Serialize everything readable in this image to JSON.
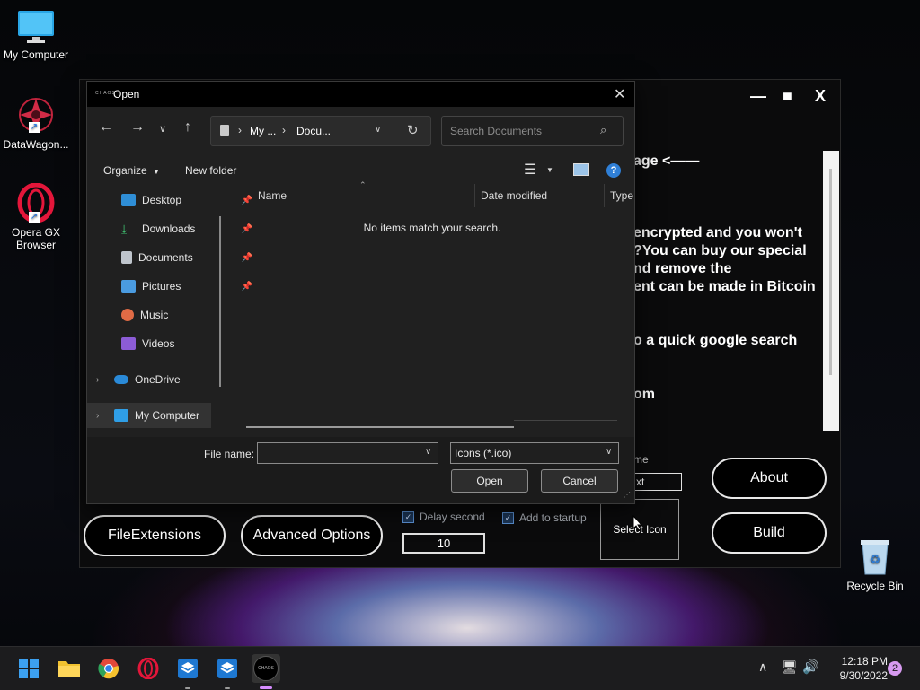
{
  "desktop": {
    "icons": [
      {
        "label": "My Computer"
      },
      {
        "label": "DataWagon..."
      },
      {
        "label": "Opera GX\nBrowser"
      },
      {
        "label": "Recycle Bin"
      }
    ]
  },
  "background_app": {
    "controls": {
      "minimize": "—",
      "maximize": "■",
      "close": "X"
    },
    "text_lines": [
      "age <——",
      "encrypted and you won't",
      "?You can buy our special",
      "nd remove the",
      "ent can be made in Bitcoin",
      "o a quick google search",
      "om"
    ],
    "name_label": "me",
    "name_input_value": "xt",
    "buttons": {
      "about": "About",
      "build": "Build",
      "file_extensions": "FileExtensions",
      "advanced_options": "Advanced Options",
      "select_icon": "Select Icon"
    },
    "delay_second_label": "Delay second",
    "add_to_startup_label": "Add to startup",
    "delay_value": "10"
  },
  "dialog": {
    "title": "Open",
    "app_logo_text": "CHAOS",
    "address": {
      "seg1": "My ...",
      "seg2": "Docu..."
    },
    "search_placeholder": "Search Documents",
    "toolbar": {
      "organize": "Organize",
      "new_folder": "New folder"
    },
    "nav": [
      {
        "label": "Desktop",
        "pinned": true
      },
      {
        "label": "Downloads",
        "pinned": true
      },
      {
        "label": "Documents",
        "pinned": true
      },
      {
        "label": "Pictures",
        "pinned": true
      },
      {
        "label": "Music",
        "pinned": false
      },
      {
        "label": "Videos",
        "pinned": false
      },
      {
        "label": "OneDrive",
        "pinned": false
      },
      {
        "label": "My Computer",
        "pinned": false
      }
    ],
    "columns": {
      "name": "Name",
      "date_modified": "Date modified",
      "type": "Type"
    },
    "empty_message": "No items match your search.",
    "footer": {
      "file_name_label": "File name:",
      "file_name_value": "",
      "file_type": "Icons (*.ico)",
      "open": "Open",
      "cancel": "Cancel"
    }
  },
  "taskbar": {
    "time": "12:18 PM",
    "date": "9/30/2022",
    "notification_count": "2"
  }
}
